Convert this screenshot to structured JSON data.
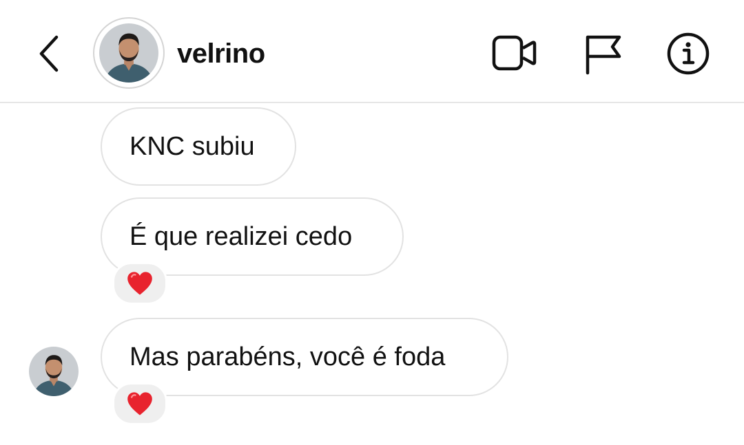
{
  "header": {
    "username": "velrino",
    "icons": [
      "back-chevron-icon",
      "avatar",
      "video-camera-icon",
      "flag-icon",
      "info-icon"
    ]
  },
  "messages": [
    {
      "text": "KNC subiu",
      "reaction": null
    },
    {
      "text": "É que realizei cedo",
      "reaction": "heart-icon"
    },
    {
      "text": "Mas parabéns, você é foda",
      "reaction": "heart-icon"
    }
  ],
  "colors": {
    "background": "#ffffff",
    "bubble_border": "#e2e2e2",
    "reaction_bg": "#efefef",
    "heart": "#e8232e",
    "text": "#111111"
  }
}
